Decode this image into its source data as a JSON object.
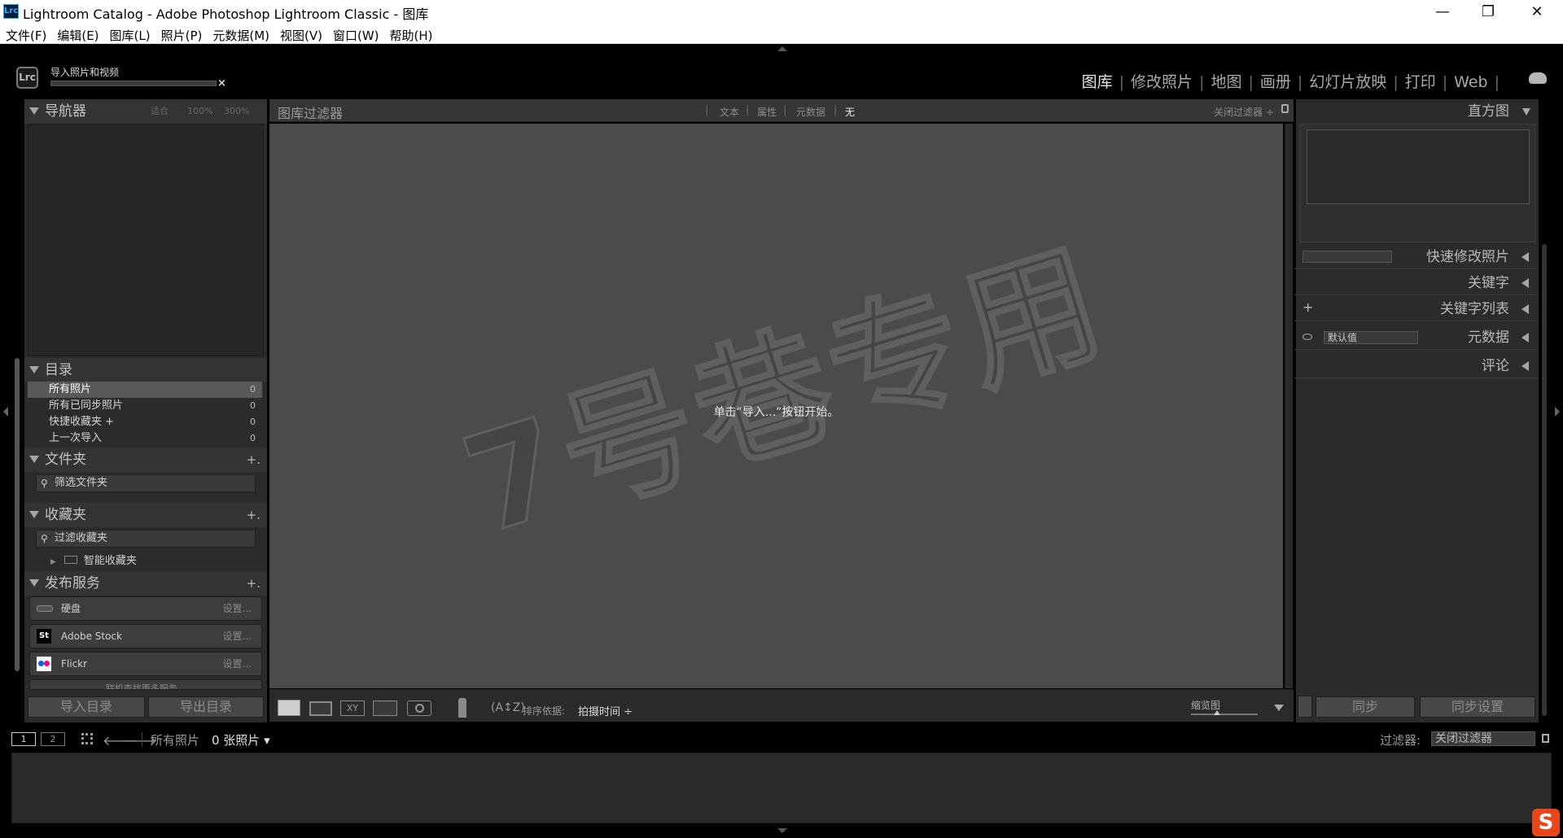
{
  "window": {
    "title": "Lightroom Catalog - Adobe Photoshop Lightroom Classic - 图库",
    "app_icon": "Lrc",
    "min": "—",
    "max": "❐",
    "close": "✕"
  },
  "menu": [
    "文件(F)",
    "编辑(E)",
    "图库(L)",
    "照片(P)",
    "元数据(M)",
    "视图(V)",
    "窗口(W)",
    "帮助(H)"
  ],
  "identity": {
    "logo": "Lrc",
    "task": "导入照片和视频",
    "task_close": "×"
  },
  "modules": [
    "图库",
    "修改照片",
    "地图",
    "画册",
    "幻灯片放映",
    "打印",
    "Web"
  ],
  "left": {
    "navigator": {
      "title": "导航器",
      "zoom": [
        "适合",
        "100%",
        "300%"
      ]
    },
    "catalog": {
      "title": "目录",
      "items": [
        {
          "label": "所有照片",
          "count": "0"
        },
        {
          "label": "所有已同步照片",
          "count": "0"
        },
        {
          "label": "快捷收藏夹 +",
          "count": "0"
        },
        {
          "label": "上一次导入",
          "count": "0"
        }
      ]
    },
    "folders": {
      "title": "文件夹",
      "add": "+.",
      "search": "筛选文件夹"
    },
    "collections": {
      "title": "收藏夹",
      "add": "+.",
      "search": "过滤收藏夹",
      "smart": "智能收藏夹"
    },
    "publish": {
      "title": "发布服务",
      "add": "+.",
      "services": [
        {
          "name": "硬盘",
          "setup": "设置..."
        },
        {
          "name": "Adobe Stock",
          "setup": "设置..."
        },
        {
          "name": "Flickr",
          "setup": "设置..."
        }
      ],
      "more": "联机查找更多服务..."
    },
    "import_btn": "导入目录",
    "export_btn": "导出目录"
  },
  "filter_bar": {
    "title": "图库过滤器",
    "tabs": [
      "文本",
      "属性",
      "元数据",
      "无"
    ],
    "preset": "关闭过滤器 ÷"
  },
  "grid": {
    "empty_msg": "单击“导入...”按钮开始。",
    "watermark": "7号巷专用"
  },
  "toolbar": {
    "sort_label": "排序依据:",
    "sort_value": "拍摄时间 ÷",
    "thumb_label": "缩览图"
  },
  "right": {
    "histogram": "直方图",
    "quick_develop": "快速修改照片",
    "keywording": "关键字",
    "keyword_list": "关键字列表",
    "keyword_add": "+",
    "metadata": "元数据",
    "metadata_preset": "默认值",
    "comments": "评论",
    "sync": "同步",
    "sync_settings": "同步设置"
  },
  "filmstrip": {
    "screen1": "1",
    "screen2": "2",
    "source": "所有照片",
    "count": "0 张照片 ▾",
    "filter_label": "过滤器:",
    "filter_value": "关闭过滤器"
  },
  "colors": {
    "panel": "#2b2b2b",
    "header": "#333333",
    "center": "#4b4b4b",
    "flickr_pink": "#ff0084",
    "flickr_blue": "#0063dc"
  }
}
